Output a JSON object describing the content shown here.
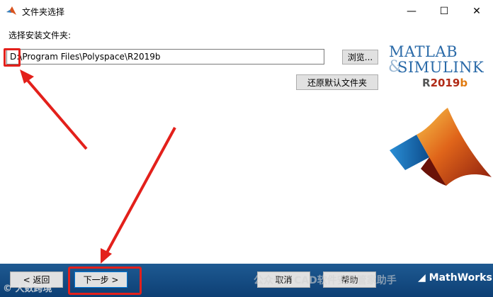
{
  "window": {
    "title": "文件夹选择",
    "minimize_glyph": "—",
    "maximize_glyph": "☐",
    "close_glyph": "✕"
  },
  "form": {
    "label": "选择安装文件夹:",
    "path_value": "D:\\Program Files\\Polyspace\\R2019b",
    "browse_label": "浏览...",
    "restore_label": "还原默认文件夹"
  },
  "logo": {
    "matlab": "MATLAB",
    "simulink": "SIMULINK",
    "ampersand": "&",
    "release_r": "R",
    "release_num": "2019",
    "release_b": "b",
    "mathworks": "MathWorks"
  },
  "footer": {
    "back_label": "< 返回",
    "next_label": "下一步 >",
    "cancel_label": "取消",
    "help_label": "帮助"
  },
  "overlay": {
    "watermark_left": "大数跨境",
    "watermark_right": "公众号 · CAD软件安装管家助手"
  },
  "colors": {
    "annotation_red": "#e3201b",
    "footer_blue": "#164e86",
    "matlab_blue": "#2a6aa8"
  }
}
